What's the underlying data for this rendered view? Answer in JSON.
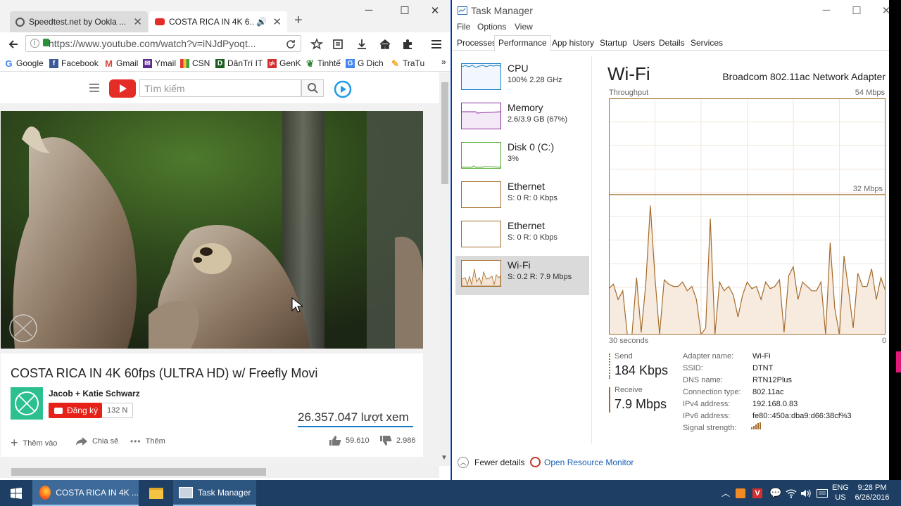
{
  "browser": {
    "tabs": [
      {
        "title": "Speedtest.net by Ookla ..."
      },
      {
        "title": "COSTA RICA IN 4K 6..."
      }
    ],
    "url": "https://www.youtube.com/watch?v=iNJdPyoqt...",
    "bookmarks": [
      "Google",
      "Facebook",
      "Gmail",
      "Ymail",
      "CSN",
      "DânTrí IT",
      "GenK",
      "Tinhtế",
      "G Dịch",
      "TraTu"
    ],
    "overflow": "»"
  },
  "youtube": {
    "search_placeholder": "Tìm kiếm",
    "video_title": "COSTA RICA IN 4K 60fps (ULTRA HD) w/ Freefly Movi",
    "channel": "Jacob + Katie Schwarz",
    "subscribe_label": "Đăng ký",
    "subscriber_count": "132 N",
    "views": "26.357.047 lượt xem",
    "add_label": "Thêm vào",
    "share_label": "Chia sẻ",
    "more_label": "Thêm",
    "likes": "59.610",
    "dislikes": "2.986"
  },
  "taskmanager": {
    "title": "Task Manager",
    "menu": [
      "File",
      "Options",
      "View"
    ],
    "tabs": [
      "Processes",
      "Performance",
      "App history",
      "Startup",
      "Users",
      "Details",
      "Services"
    ],
    "active_tab": "Performance",
    "sidebar": [
      {
        "name": "CPU",
        "value": "100%  2.28 GHz",
        "color": "#1a7fc7"
      },
      {
        "name": "Memory",
        "value": "2.6/3.9 GB (67%)",
        "color": "#8b2f9e"
      },
      {
        "name": "Disk 0 (C:)",
        "value": "3%",
        "color": "#4ea72e"
      },
      {
        "name": "Ethernet",
        "value": "S: 0  R: 0 Kbps",
        "color": "#a36b2a"
      },
      {
        "name": "Ethernet",
        "value": "S: 0  R: 0 Kbps",
        "color": "#a36b2a"
      },
      {
        "name": "Wi-Fi",
        "value": "S: 0.2  R: 7.9 Mbps",
        "color": "#a36b2a"
      }
    ],
    "detail": {
      "title": "Wi-Fi",
      "adapter": "Broadcom 802.11ac Network Adapter",
      "throughput_label": "Throughput",
      "max_label": "54 Mbps",
      "mid_label": "32 Mbps",
      "time_left": "30 seconds",
      "time_right": "0",
      "send_label": "Send",
      "send_value": "184 Kbps",
      "receive_label": "Receive",
      "receive_value": "7.9 Mbps",
      "props": [
        {
          "k": "Adapter name:",
          "v": "Wi-Fi"
        },
        {
          "k": "SSID:",
          "v": "DTNT"
        },
        {
          "k": "DNS name:",
          "v": "RTN12Plus"
        },
        {
          "k": "Connection type:",
          "v": "802.11ac"
        },
        {
          "k": "IPv4 address:",
          "v": "192.168.0.83"
        },
        {
          "k": "IPv6 address:",
          "v": "fe80::450a:dba9:d66:38cf%3"
        },
        {
          "k": "Signal strength:",
          "v": ""
        }
      ]
    },
    "fewer_details": "Fewer details",
    "open_resource_monitor": "Open Resource Monitor"
  },
  "taskbar": {
    "items": [
      "COSTA RICA IN 4K ...",
      "Task Manager"
    ],
    "lang": "ENG",
    "region": "US",
    "time": "9:28 PM",
    "date": "6/26/2016"
  },
  "chart_data": {
    "type": "area",
    "title": "Throughput",
    "ylabel": "",
    "ylim": [
      0,
      54
    ],
    "y_ticks": [
      "54 Mbps",
      "32 Mbps"
    ],
    "x_range_label": [
      "30 seconds",
      "0"
    ],
    "series": [
      {
        "values": [
          10.5,
          11.5,
          8,
          10,
          0,
          0,
          13,
          0.5,
          11.5,
          29.5,
          13,
          0,
          12.5,
          11.5,
          11,
          11,
          12,
          10,
          11,
          8,
          0,
          1.5,
          26.5,
          0,
          12,
          10,
          11,
          9,
          4,
          9,
          12,
          10.5,
          11,
          8,
          12,
          10.5,
          11,
          12.5,
          0.5,
          13.5,
          15.5,
          8,
          12,
          11,
          10,
          10,
          12,
          0,
          21,
          6,
          0,
          18,
          10,
          1.5,
          14,
          11,
          11,
          15,
          8,
          13,
          10
        ]
      }
    ],
    "grid": true,
    "color": "#a36b2a"
  }
}
